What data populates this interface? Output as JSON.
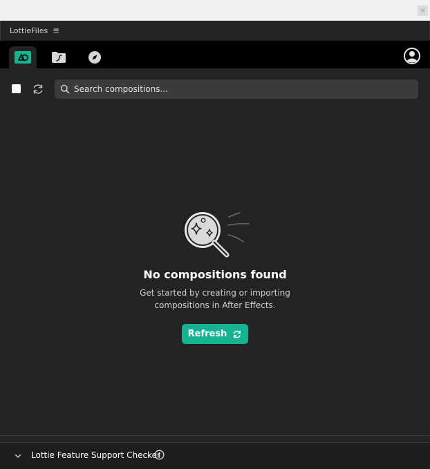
{
  "window": {
    "close_label": "×"
  },
  "panel": {
    "name": "LottieFiles",
    "menu_glyph": "≡"
  },
  "tabs": [
    {
      "name": "compositions",
      "icon": "compositions-icon",
      "active": true
    },
    {
      "name": "local-files",
      "icon": "folder-icon",
      "active": false
    },
    {
      "name": "discover",
      "icon": "compass-icon",
      "active": false
    }
  ],
  "toolbar": {
    "search_placeholder": "Search compositions..."
  },
  "empty_state": {
    "title": "No compositions found",
    "description": "Get started by creating or importing compositions in After Effects.",
    "button_label": "Refresh"
  },
  "footer": {
    "label": "Lottie Feature Support Checker"
  },
  "colors": {
    "accent": "#15b392",
    "background": "#232323",
    "tabbar": "#000000"
  }
}
